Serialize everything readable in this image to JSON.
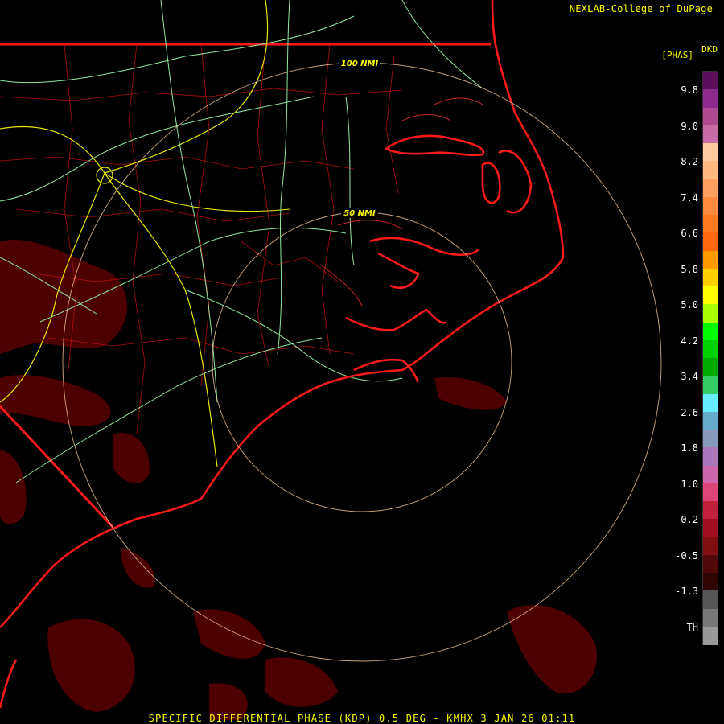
{
  "credit": "NEXLAB-College of DuPage",
  "legend": {
    "product": "DKD",
    "unit": "[PHAS]",
    "ticks": [
      "9.8",
      "9.0",
      "8.2",
      "7.4",
      "6.6",
      "5.8",
      "5.0",
      "4.2",
      "3.4",
      "2.6",
      "1.8",
      "1.0",
      "0.2",
      "-0.5",
      "-1.3",
      "TH"
    ],
    "colors": [
      "#5a0f5a",
      "#8e2a8e",
      "#b04a90",
      "#c86aa6",
      "#ffc9a0",
      "#ffb880",
      "#ffa060",
      "#ff8a40",
      "#ff7a20",
      "#ff6a10",
      "#ff9a00",
      "#ffd000",
      "#ffff00",
      "#aaff00",
      "#00ff00",
      "#00d000",
      "#00aa00",
      "#33cc66",
      "#66eeff",
      "#66aacc",
      "#8899bb",
      "#aa77bb",
      "#cc66aa",
      "#dd4477",
      "#c0203a",
      "#a01020",
      "#801010",
      "#500808",
      "#300505",
      "#555555",
      "#777777",
      "#999999"
    ]
  },
  "rings": {
    "inner_label": "50 NMI",
    "outer_label": "100 NMI"
  },
  "footer": "SPECIFIC DIFFERENTIAL PHASE (KDP) 0.5 DEG - KMHX 3 JAN 26 01:11"
}
